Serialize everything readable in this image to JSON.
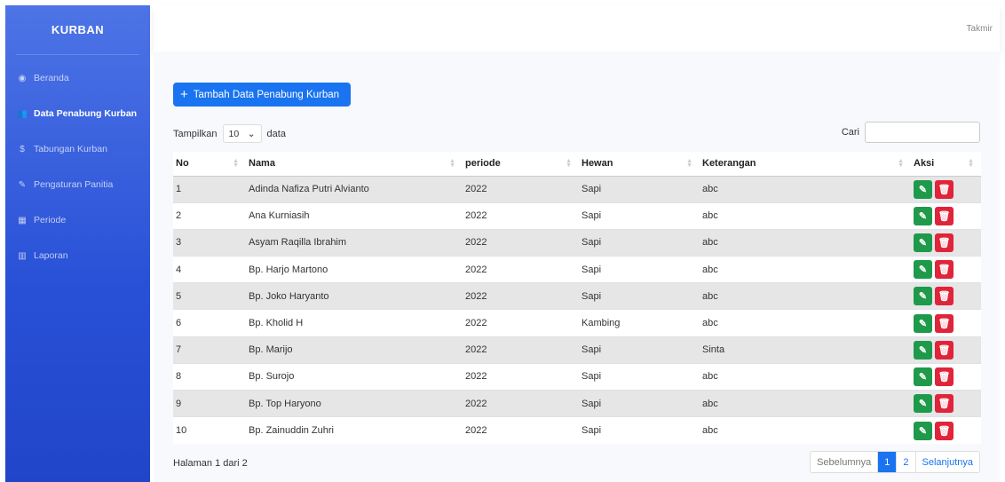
{
  "sidebar": {
    "brand": "KURBAN",
    "items": [
      {
        "label": "Beranda",
        "icon": "dashboard-icon"
      },
      {
        "label": "Data Penabung Kurban",
        "icon": "users-icon",
        "active": true
      },
      {
        "label": "Tabungan Kurban",
        "icon": "dollar-icon"
      },
      {
        "label": "Pengaturan Panitia",
        "icon": "wrench-icon"
      },
      {
        "label": "Periode",
        "icon": "calendar-icon"
      },
      {
        "label": "Laporan",
        "icon": "report-icon"
      }
    ]
  },
  "topbar": {
    "user": "Takmir"
  },
  "main": {
    "add_button": "Tambah Data Penabung Kurban",
    "length_prefix": "Tampilkan",
    "length_value": "10",
    "length_suffix": "data",
    "search_label": "Cari",
    "columns": [
      "No",
      "Nama",
      "periode",
      "Hewan",
      "Keterangan",
      "Aksi"
    ],
    "rows": [
      [
        "1",
        "Adinda Nafiza Putri Alvianto",
        "2022",
        "Sapi",
        "abc"
      ],
      [
        "2",
        "Ana Kurniasih",
        "2022",
        "Sapi",
        "abc"
      ],
      [
        "3",
        "Asyam Raqilla Ibrahim",
        "2022",
        "Sapi",
        "abc"
      ],
      [
        "4",
        "Bp. Harjo Martono",
        "2022",
        "Sapi",
        "abc"
      ],
      [
        "5",
        "Bp. Joko Haryanto",
        "2022",
        "Sapi",
        "abc"
      ],
      [
        "6",
        "Bp. Kholid H",
        "2022",
        "Kambing",
        "abc"
      ],
      [
        "7",
        "Bp. Marijo",
        "2022",
        "Sapi",
        "Sinta"
      ],
      [
        "8",
        "Bp. Surojo",
        "2022",
        "Sapi",
        "abc"
      ],
      [
        "9",
        "Bp. Top Haryono",
        "2022",
        "Sapi",
        "abc"
      ],
      [
        "10",
        "Bp. Zainuddin Zuhri",
        "2022",
        "Sapi",
        "abc"
      ]
    ],
    "info": "Halaman 1 dari 2",
    "pager": {
      "prev": "Sebelumnya",
      "pages": [
        "1",
        "2"
      ],
      "next": "Selanjutnya"
    }
  },
  "colors": {
    "primary": "#1a73f0",
    "sidebar": "#2850d6",
    "edit": "#1e9a4a",
    "delete": "#e0243a"
  }
}
